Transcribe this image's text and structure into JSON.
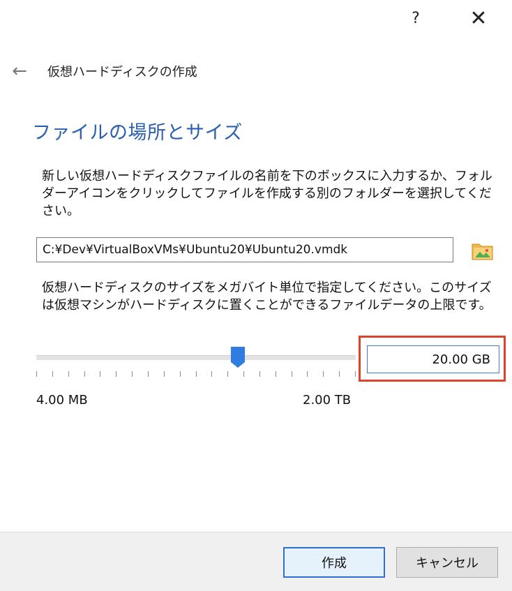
{
  "titlebar": {
    "help_label": "?",
    "close_label": "✕"
  },
  "header": {
    "back_label": "←",
    "title": "仮想ハードディスクの作成"
  },
  "section_title": "ファイルの場所とサイズ",
  "location": {
    "description": "新しい仮想ハードディスクファイルの名前を下のボックスに入力するか、フォルダーアイコンをクリックしてファイルを作成する別のフォルダーを選択してください。",
    "path_value": "C:¥Dev¥VirtualBoxVMs¥Ubuntu20¥Ubuntu20.vmdk",
    "folder_icon": "folder-icon"
  },
  "size": {
    "description": "仮想ハードディスクのサイズをメガバイト単位で指定してください。このサイズは仮想マシンがハードディスクに置くことができるファイルデータの上限です。",
    "slider_position_fraction": 0.63,
    "tick_count": 21,
    "min_label": "4.00 MB",
    "max_label": "2.00 TB",
    "value": "20.00 GB"
  },
  "buttons": {
    "create_label": "作成",
    "cancel_label": "キャンセル"
  },
  "colors": {
    "accent_title": "#2a5fb3",
    "highlight": "#e0432b",
    "slider_thumb": "#2f7de1"
  }
}
